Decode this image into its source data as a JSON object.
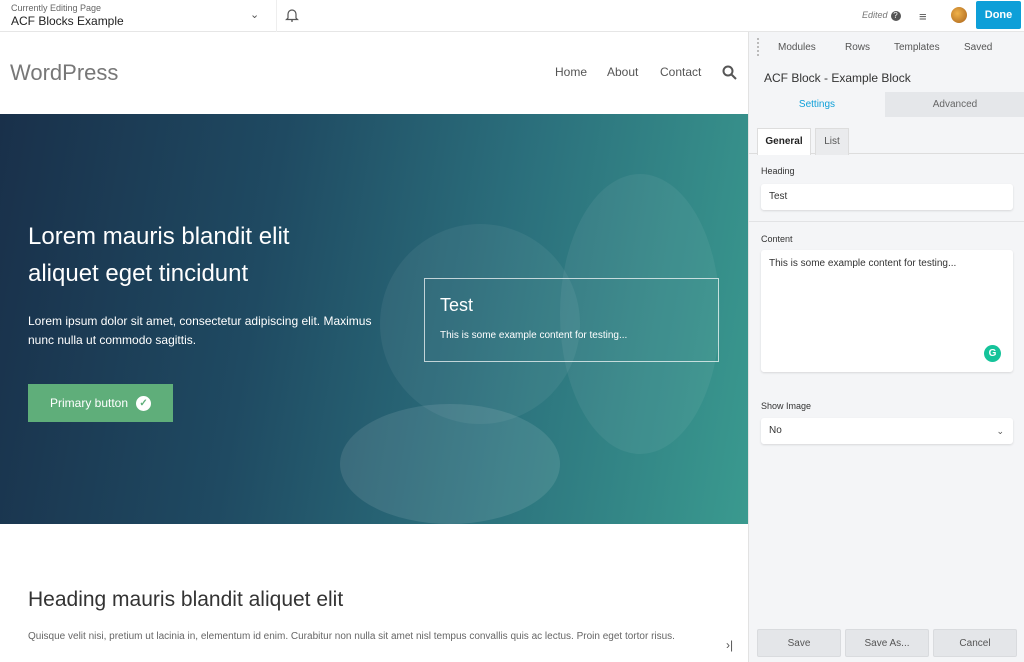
{
  "topbar": {
    "editing_label": "Currently Editing Page",
    "page_title": "ACF Blocks Example",
    "status": "Edited",
    "done_label": "Done"
  },
  "site": {
    "logo": "WordPress",
    "nav": [
      "Home",
      "About",
      "Contact"
    ]
  },
  "hero": {
    "heading": "Lorem mauris blandit elit aliquet eget tincidunt",
    "text": "Lorem ipsum dolor sit amet, consectetur adipiscing elit. Maximus nunc nulla ut commodo sagittis.",
    "button_label": "Primary button",
    "block_heading": "Test",
    "block_content": "This is some example content for testing..."
  },
  "section": {
    "heading": "Heading mauris blandit aliquet elit",
    "text": "Quisque velit nisi, pretium ut lacinia in, elementum id enim. Curabitur non nulla sit amet nisl tempus convallis quis ac lectus. Proin eget tortor risus."
  },
  "panel": {
    "tabs": [
      "Modules",
      "Rows",
      "Templates",
      "Saved"
    ],
    "title": "ACF Block - Example Block",
    "settings_tabs": [
      "Settings",
      "Advanced"
    ],
    "sub_tabs": [
      "General",
      "List"
    ],
    "heading_label": "Heading",
    "heading_value": "Test",
    "content_label": "Content",
    "content_value": "This is some example content for testing...",
    "show_image_label": "Show Image",
    "show_image_value": "No",
    "buttons": [
      "Save",
      "Save As...",
      "Cancel"
    ]
  },
  "colors": {
    "accent": "#0e9fd8",
    "button_green": "#5fae7a",
    "hero_dark": "#19304a"
  }
}
